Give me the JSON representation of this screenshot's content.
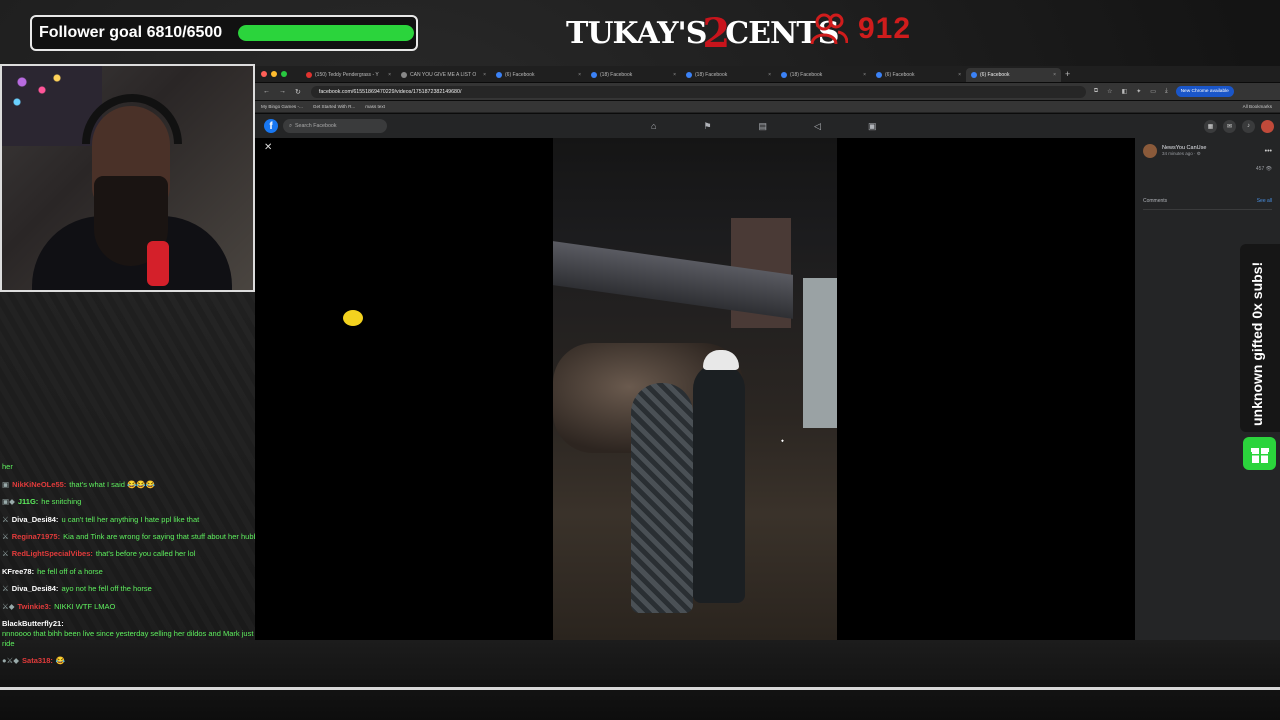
{
  "overlay": {
    "follower_goal_text": "Follower goal 6810/6500",
    "follower_goal_progress": 1.0,
    "logo_left": "TUKAY'S",
    "logo_two": "2",
    "logo_right": "CENTS",
    "viewer_count": "912",
    "subs_text": "unknown gifted 0x subs!",
    "accent_green": "#2bd43c",
    "accent_red": "#d01c1c"
  },
  "chat": [
    {
      "user": "",
      "text": "her",
      "user_color": "#5ef05e",
      "badges": ""
    },
    {
      "user": "NikKiNeOLe55:",
      "text": "that's what I said 😂😂😂",
      "user_color": "#e23b3b",
      "badges": "▣"
    },
    {
      "user": "J11G:",
      "text": "he snitching",
      "user_color": "#5ef05e",
      "badges": "▣◆"
    },
    {
      "user": "Diva_Desi84:",
      "text": "u can't tell her anything I hate ppl like that",
      "user_color": "#ffffff",
      "badges": "⚔"
    },
    {
      "user": "Regina71975:",
      "text": "Kia and Tink are wrong for saying that stuff about her hubbie",
      "user_color": "#e23b3b",
      "badges": "⚔"
    },
    {
      "user": "RedLightSpecialVibes:",
      "text": "that's before you called her lol",
      "user_color": "#e23b3b",
      "badges": "⚔"
    },
    {
      "user": "KFree78:",
      "text": "he fell off of a horse",
      "user_color": "#ffffff",
      "badges": ""
    },
    {
      "user": "Diva_Desi84:",
      "text": "ayo not he fell off the horse",
      "user_color": "#ffffff",
      "badges": "⚔"
    },
    {
      "user": "Twinkie3:",
      "text": "NIKKI WTF LMAO",
      "user_color": "#e23b3b",
      "badges": "⚔◆"
    },
    {
      "user": "BlackButterfly21:",
      "text": "nnnoooo that bihh been live since yesterday selling her dildos and Mark just let it ride",
      "user_color": "#ffffff",
      "badges": ""
    },
    {
      "user": "Sata318:",
      "text": "😂",
      "user_color": "#e23b3b",
      "badges": "●⚔◆"
    }
  ],
  "browser": {
    "tabs": [
      {
        "label": "(150) Teddy Pendergrass - Y",
        "fav": "red",
        "active": false
      },
      {
        "label": "CAN YOU GIVE ME A LIST O",
        "fav": "gray",
        "active": false
      },
      {
        "label": "(6) Facebook",
        "fav": "blue",
        "active": false
      },
      {
        "label": "(18) Facebook",
        "fav": "blue",
        "active": false
      },
      {
        "label": "(18) Facebook",
        "fav": "blue",
        "active": false
      },
      {
        "label": "(18) Facebook",
        "fav": "blue",
        "active": false
      },
      {
        "label": "(6) Facebook",
        "fav": "blue",
        "active": false
      },
      {
        "label": "(6) Facebook",
        "fav": "blue",
        "active": true
      }
    ],
    "url": "facebook.com/61551869470229/videos/1751872382149680/",
    "update_label": "New Chrome available",
    "bookmarks": [
      "My Bingo Games -...",
      "Get Started With R...",
      "mass text"
    ],
    "all_bookmarks": "All Bookmarks"
  },
  "facebook": {
    "search_placeholder": "Search Facebook",
    "logo_letter": "f",
    "post_author": "NewsYou CanUse",
    "post_time": "34 minutes ago · ⚙",
    "views": "457 👁",
    "comments_label": "Comments",
    "see_all": "See all"
  }
}
